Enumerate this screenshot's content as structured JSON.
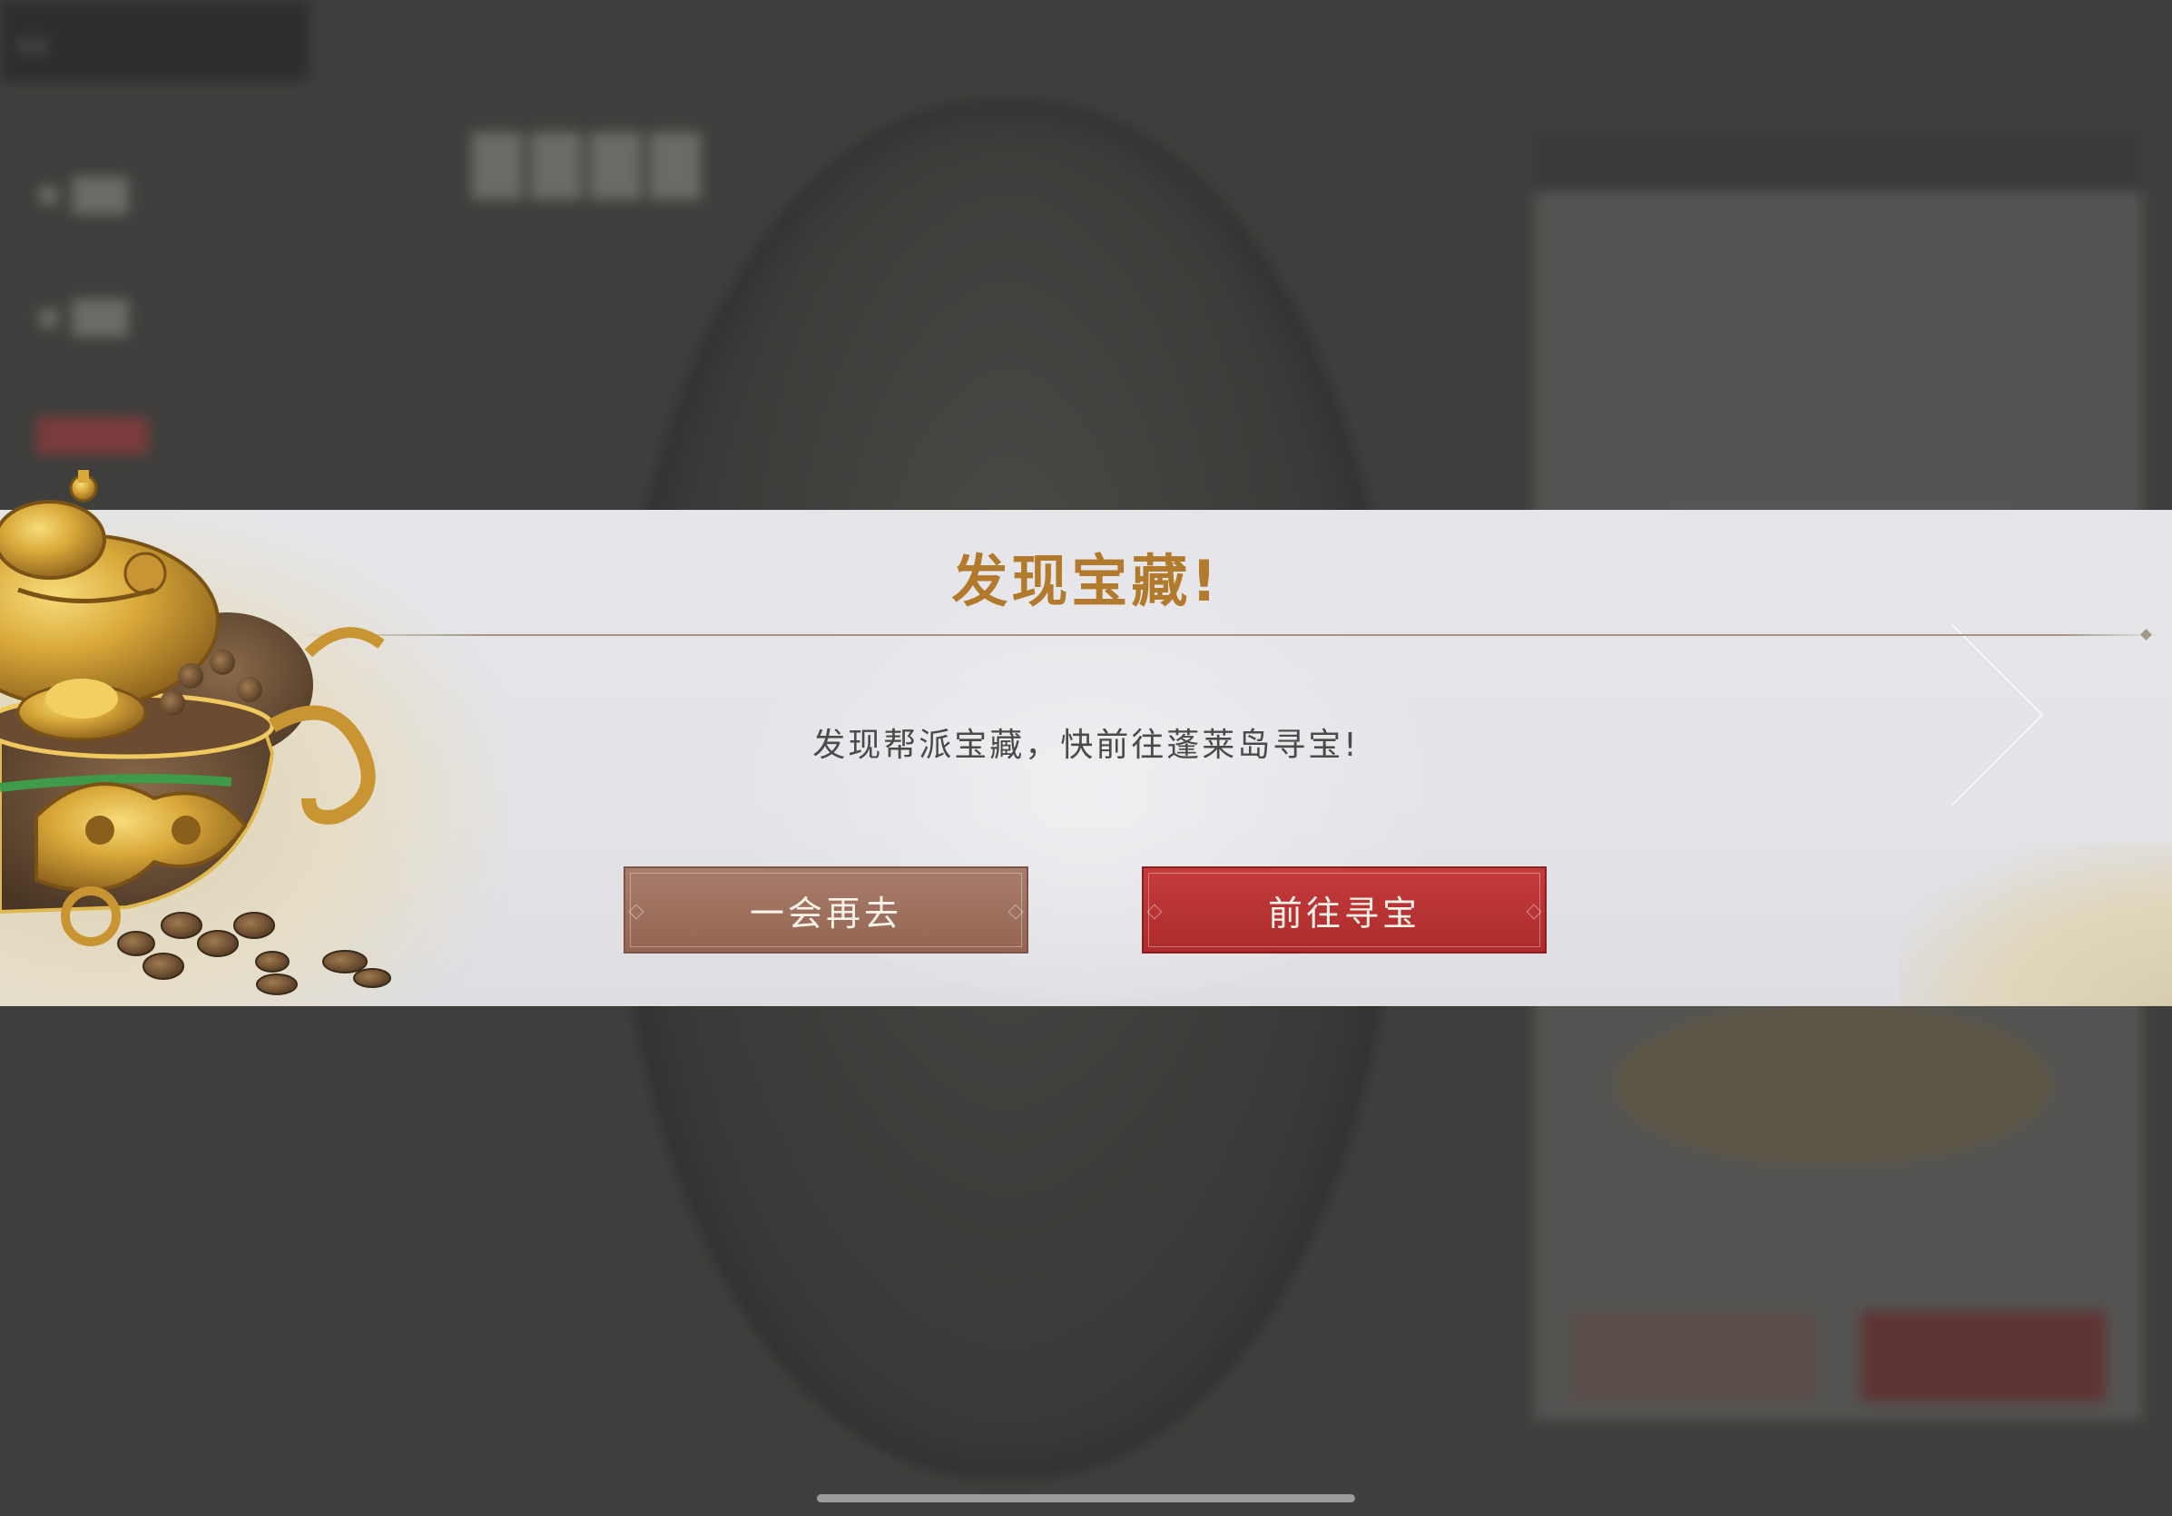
{
  "dialog": {
    "title": "发现宝藏!",
    "message": "发现帮派宝藏，快前往蓬莱岛寻宝!",
    "buttons": {
      "later_label": "一会再去",
      "go_label": "前往寻宝"
    }
  },
  "colors": {
    "title": "#b27a2c",
    "later_button": "#a0715f",
    "go_button": "#b73334",
    "banner": "#e4e4e8"
  },
  "icons": {
    "treasure_illustration": "golden-toad-treasure-pot-icon",
    "back": "back-arrow-icon"
  }
}
